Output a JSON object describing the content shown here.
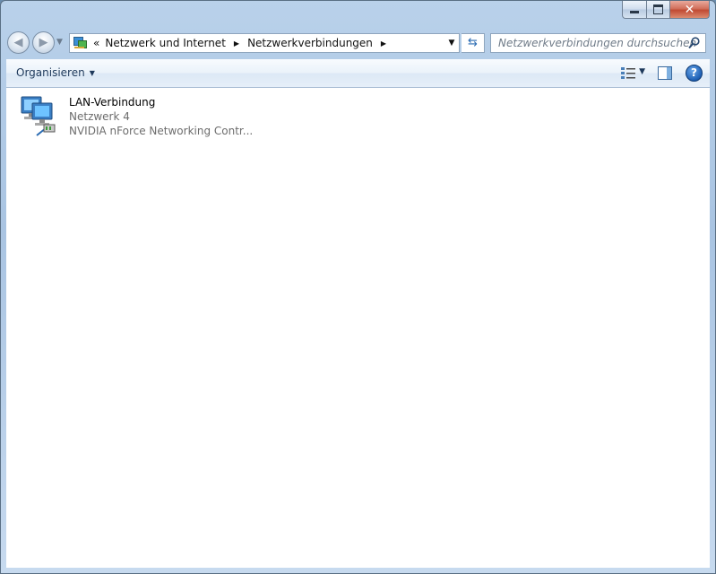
{
  "window": {
    "caption_buttons": {
      "minimize": "minimize-icon",
      "maximize": "maximize-icon",
      "close": "close-icon"
    }
  },
  "navigation": {
    "back_icon": "arrow-left-icon",
    "forward_icon": "arrow-right-icon",
    "breadcrumb_overflow": "«",
    "breadcrumbs": [
      "Netzwerk und Internet",
      "Netzwerkverbindungen"
    ],
    "refresh_icon": "refresh-icon",
    "search_placeholder": "Netzwerkverbindungen durchsuchen"
  },
  "toolbar": {
    "organize_label": "Organisieren",
    "views_icon": "change-view-icon",
    "preview_icon": "preview-pane-icon",
    "help_label": "?"
  },
  "items": [
    {
      "name": "LAN-Verbindung",
      "network": "Netzwerk  4",
      "adapter": "NVIDIA nForce Networking Contr...",
      "icon": "network-connection-icon"
    }
  ]
}
